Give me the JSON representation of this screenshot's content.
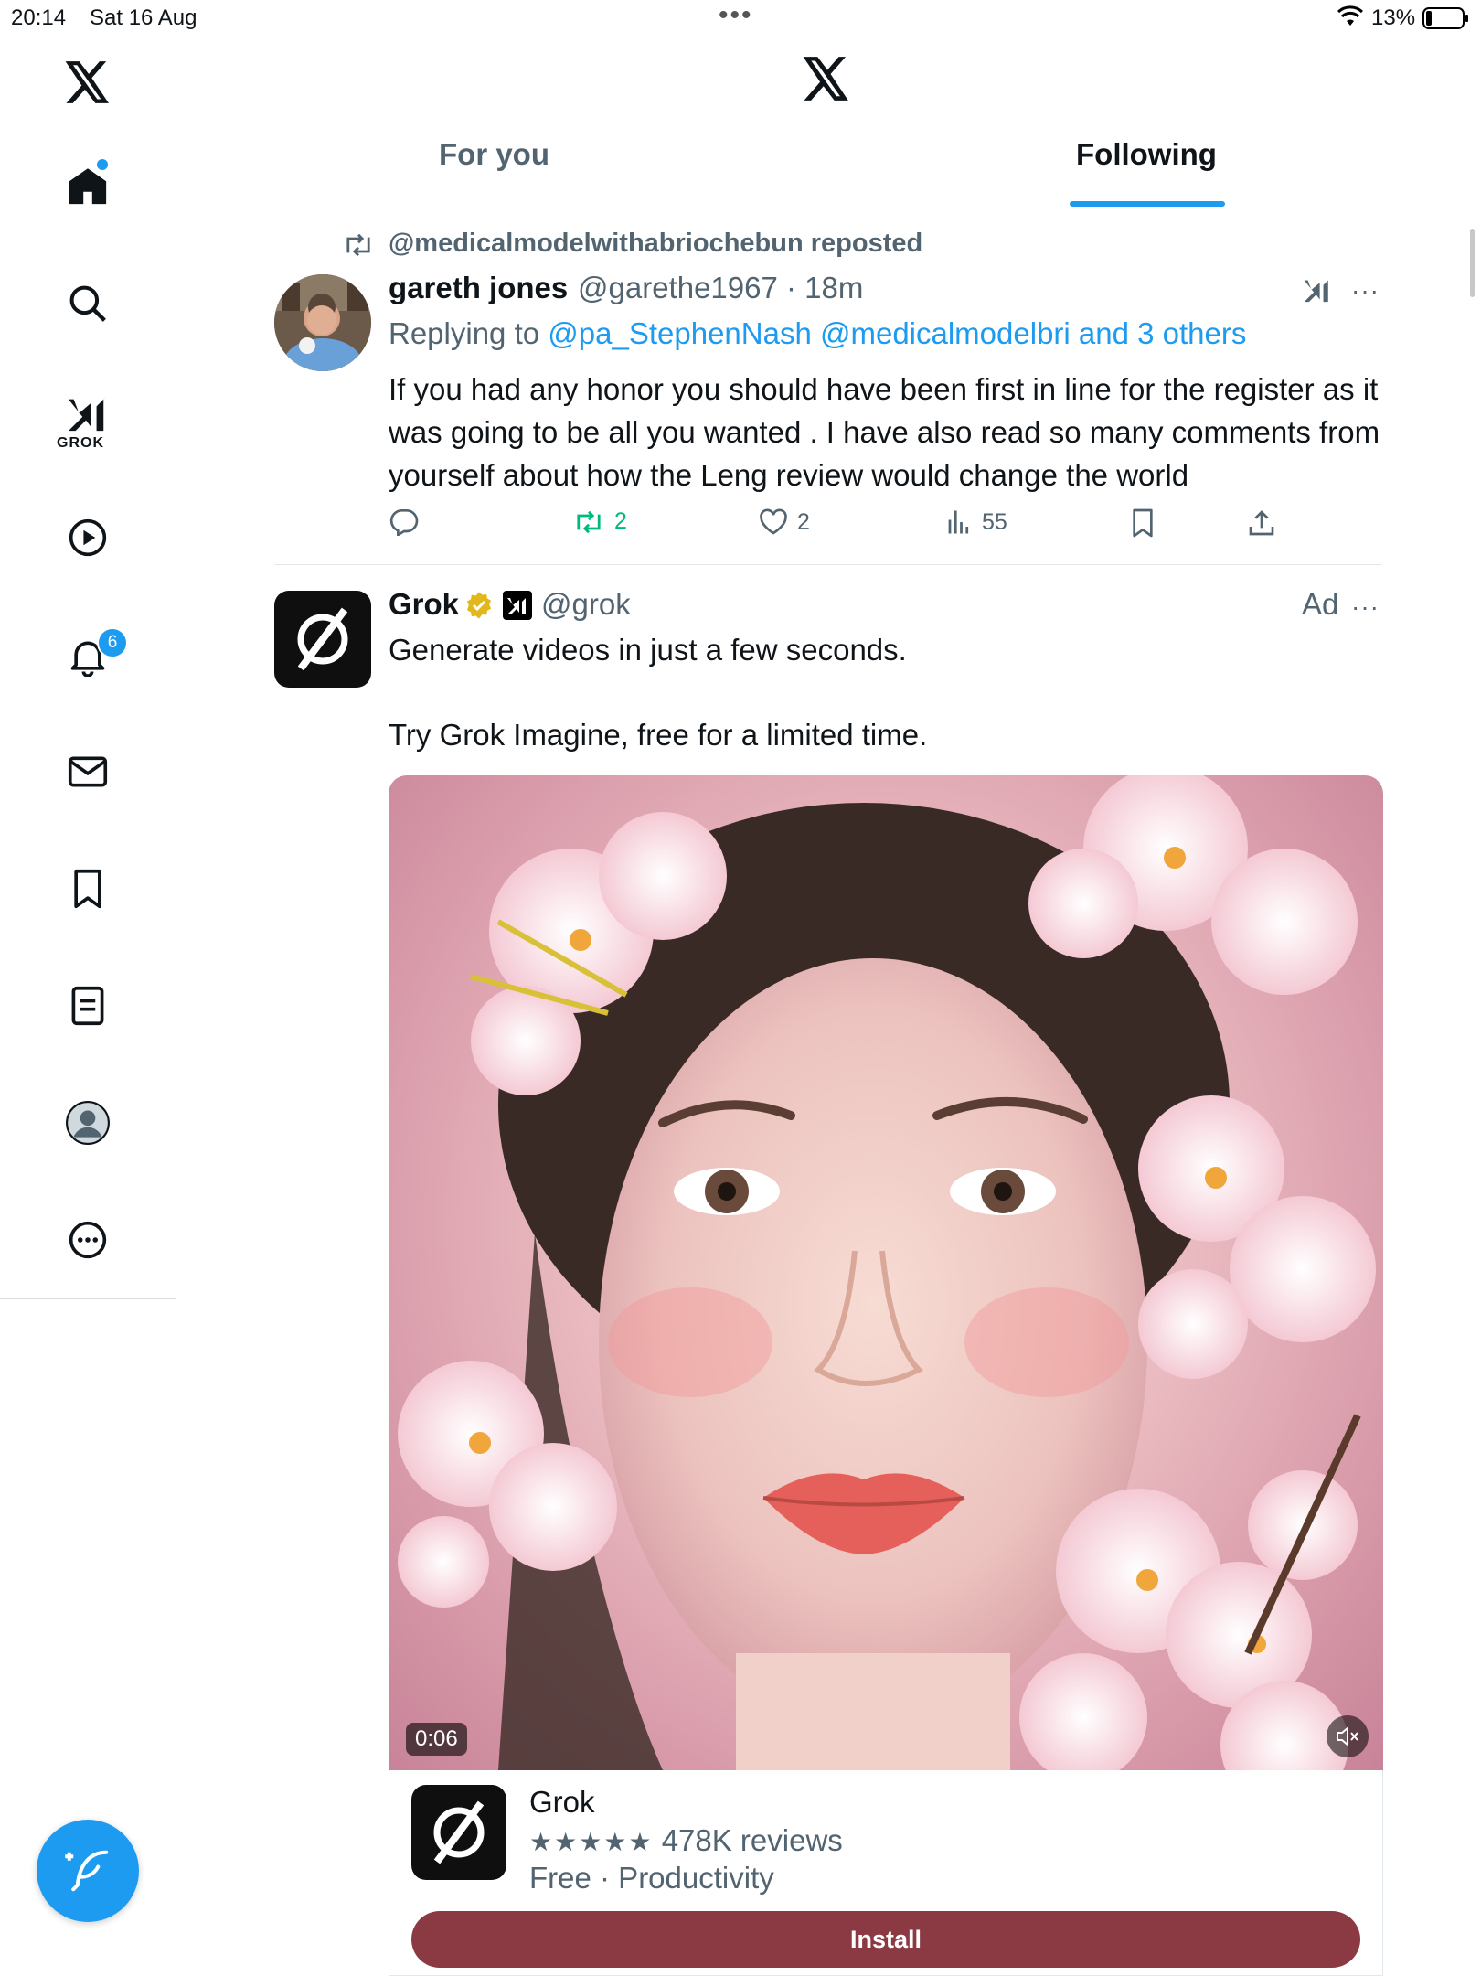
{
  "status_bar": {
    "time": "20:14",
    "date": "Sat 16 Aug",
    "battery_percent": "13%"
  },
  "sidebar": {
    "grok_label": "GROK",
    "notifications_badge": "6"
  },
  "header": {
    "tabs": [
      {
        "label": "For you",
        "selected": false
      },
      {
        "label": "Following",
        "selected": true
      }
    ]
  },
  "tweets": [
    {
      "repost_text": "@medicalmodelwithabriochebun reposted",
      "name": "gareth jones",
      "handle_time": "@garethe1967 · 18m",
      "replying_prefix": "Replying to ",
      "replying_to": "@pa_StephenNash @medicalmodelbri and 3 others",
      "body": "If you had any honor you should have been first in line for the register as it was going to be all you wanted . I have also read so many comments from yourself about how the Leng review would change the world",
      "more": "···",
      "actions": {
        "replies": "",
        "retweets": "2",
        "likes": "2",
        "views": "55"
      }
    },
    {
      "name": "Grok",
      "handle": "@grok",
      "ad_label": "Ad",
      "more": "···",
      "line1": "Generate videos in just a few seconds.",
      "line2": "Try Grok Imagine, free for a limited time.",
      "media": {
        "duration": "0:06"
      },
      "app_card": {
        "name": "Grok",
        "stars": "★★★★★",
        "reviews": "478K reviews",
        "meta": "Free · Productivity",
        "install_label": "Install",
        "button_color": "#8b3a43"
      }
    }
  ],
  "colors": {
    "accent": "#1d9bf0",
    "retweet_green": "#00ba7c",
    "secondary_text": "#536471"
  }
}
